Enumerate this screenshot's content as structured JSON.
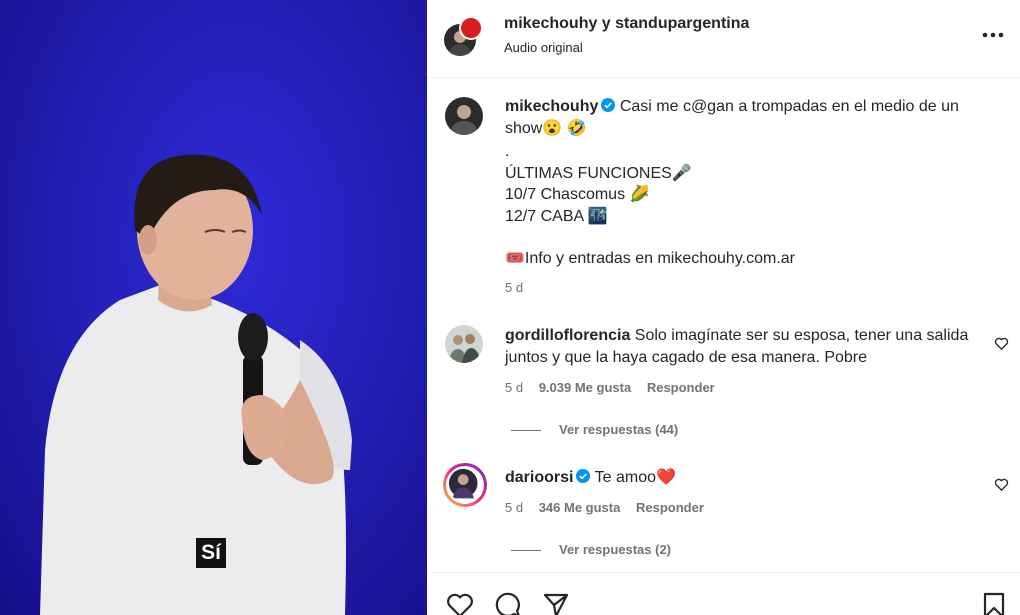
{
  "video": {
    "caption": "Sí"
  },
  "header": {
    "title": "mikechouhy y standupargentina",
    "subtitle": "Audio original"
  },
  "post": {
    "username": "mikechouhy",
    "line1": "Casi me c@gan a trompadas en el medio de un show😮 🤣",
    "line2": ".",
    "line3": "ÚLTIMAS FUNCIONES🎤",
    "line4": "10/7 Chascomus 🌽",
    "line5": "12/7 CABA 🌃",
    "line6": "🎟️Info y entradas en mikechouhy.com.ar",
    "time": "5 d"
  },
  "comments": [
    {
      "username": "gordilloflorencia",
      "text": "Solo imagínate ser su esposa, tener una salida juntos y que la haya cagado de esa manera. Pobre",
      "time": "5 d",
      "likes": "9.039 Me gusta",
      "reply": "Responder",
      "replies": "Ver respuestas (44)"
    },
    {
      "username": "darioorsi",
      "text": "Te amoo❤️",
      "time": "5 d",
      "likes": "346 Me gusta",
      "reply": "Responder",
      "replies": "Ver respuestas (2)"
    }
  ],
  "colors": {
    "verified": "#0095f6",
    "muted": "#737373",
    "video_bg": "#2320b8"
  }
}
